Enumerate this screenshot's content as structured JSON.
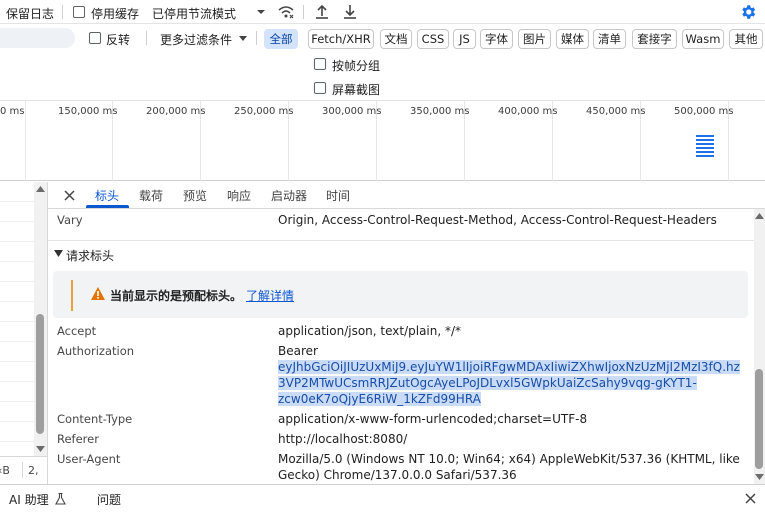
{
  "toolbar": {
    "preserve_log": "保留日志",
    "disable_cache": "停用缓存",
    "throttling": "已停用节流模式"
  },
  "filters": {
    "invert": "反转",
    "more_filters": "更多过滤条件",
    "types": [
      "全部",
      "Fetch/XHR",
      "文档",
      "CSS",
      "JS",
      "字体",
      "图片",
      "媒体",
      "清单",
      "套接字",
      "Wasm",
      "其他"
    ]
  },
  "options": {
    "group_by_frame": "按帧分组",
    "screenshots": "屏幕截图"
  },
  "timeline": {
    "ticks": [
      "0 ms",
      "150,000 ms",
      "200,000 ms",
      "250,000 ms",
      "300,000 ms",
      "350,000 ms",
      "400,000 ms",
      "450,000 ms",
      "500,000 ms"
    ]
  },
  "left_pane": {
    "footer_a": "‹B",
    "footer_b": "2,"
  },
  "detail_tabs": [
    "标头",
    "载荷",
    "预览",
    "响应",
    "启动器",
    "时间"
  ],
  "vary": {
    "name": "Vary",
    "value": "Origin, Access-Control-Request-Method, Access-Control-Request-Headers"
  },
  "request_headers": {
    "section_title": "请求标头",
    "warning_text": "当前显示的是预配标头。",
    "warning_link": "了解详情",
    "accept": {
      "name": "Accept",
      "value": "application/json, text/plain, */*"
    },
    "authorization": {
      "name": "Authorization",
      "value_prefix": "Bearer",
      "token_line1": "eyJhbGciOiJIUzUxMiJ9.eyJuYW1lIjoiRFgwMDAxIiwiZXhwIjoxNzUzMjI2MzI3fQ.hz",
      "token_line2": "3VP2MTwUCsmRRJZutOgcAyeLPoJDLvxl5GWpkUaiZcSahy9vqg-gKYT1-",
      "token_line3": "zcw0eK7oQjyE6RiW_1kZFd99HRA"
    },
    "content_type": {
      "name": "Content-Type",
      "value": "application/x-www-form-urlencoded;charset=UTF-8"
    },
    "referer": {
      "name": "Referer",
      "value": "http://localhost:8080/"
    },
    "user_agent": {
      "name": "User-Agent",
      "value_line1": "Mozilla/5.0 (Windows NT 10.0; Win64; x64) AppleWebKit/537.36 (KHTML, like",
      "value_line2": "Gecko) Chrome/137.0.0.0 Safari/537.36"
    }
  },
  "bottom": {
    "ai_assistant": "AI 助理",
    "issues": "问题"
  },
  "colors": {
    "accent": "#0b57d0",
    "warning": "#e37400",
    "selection": "#c9dbf7"
  }
}
